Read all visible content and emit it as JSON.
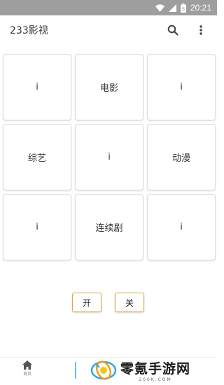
{
  "status_bar": {
    "time": "20:21",
    "battery_label": "5"
  },
  "app_bar": {
    "title": "233影视",
    "search_icon": "search-icon",
    "more_icon": "more-vert-icon"
  },
  "grid": {
    "cells": [
      {
        "label": "i"
      },
      {
        "label": "电影"
      },
      {
        "label": "i"
      },
      {
        "label": "综艺"
      },
      {
        "label": "i"
      },
      {
        "label": "动漫"
      },
      {
        "label": "i"
      },
      {
        "label": "连续剧"
      },
      {
        "label": "i"
      }
    ]
  },
  "toggles": {
    "on_label": "开",
    "off_label": "关",
    "border_color": "#e0a43a"
  },
  "bottom_nav": {
    "home_label": "首页",
    "home_icon": "home-icon"
  },
  "watermark": {
    "name": "零氪手游网",
    "url": "260K.COM"
  }
}
